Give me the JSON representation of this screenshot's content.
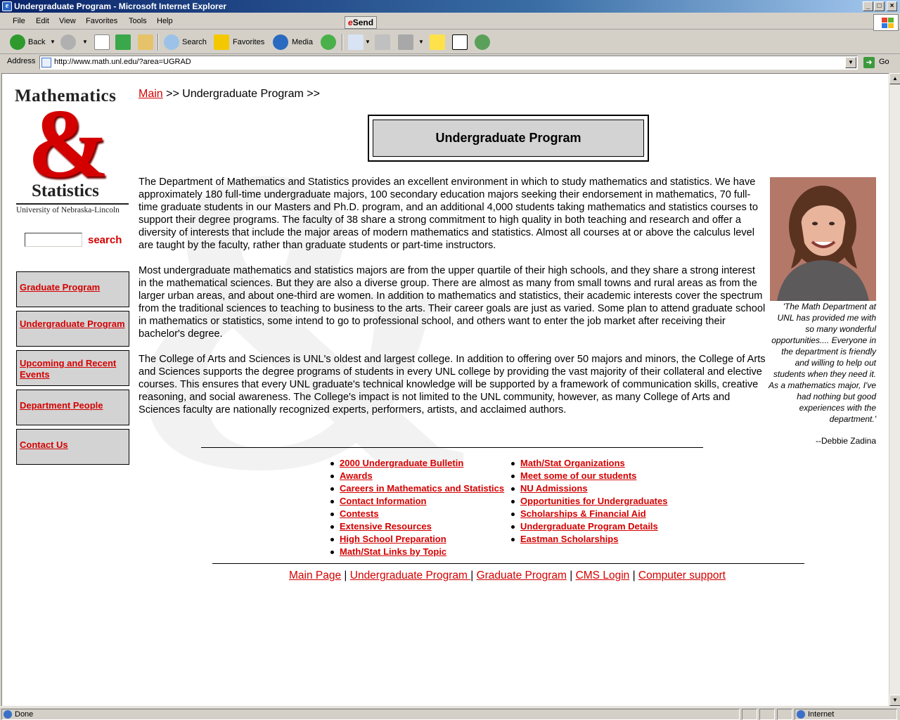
{
  "window": {
    "title": "Undergraduate Program - Microsoft Internet Explorer",
    "controls": {
      "minimize": "_",
      "maximize": "□",
      "close": "×"
    }
  },
  "menu": [
    "File",
    "Edit",
    "View",
    "Favorites",
    "Tools",
    "Help"
  ],
  "send_button": {
    "prefix": "e",
    "label": "Send"
  },
  "toolbar": {
    "back": "Back",
    "search": "Search",
    "favorites": "Favorites",
    "media": "Media"
  },
  "address": {
    "label": "Address",
    "url": "http://www.math.unl.edu/?area=UGRAD",
    "go": "Go"
  },
  "logo": {
    "line1": "Mathematics",
    "amp": "&",
    "line2": "Statistics",
    "line3": "University of Nebraska-Lincoln"
  },
  "search": {
    "value": "",
    "label": "search"
  },
  "sidebar_nav": [
    {
      "label": "Graduate Program"
    },
    {
      "label": "Undergraduate Program"
    },
    {
      "label": "Upcoming and Recent Events"
    },
    {
      "label": "Department People"
    },
    {
      "label": "Contact Us"
    }
  ],
  "breadcrumb": {
    "link": "Main",
    "rest": " >> Undergraduate Program >>"
  },
  "heading": "Undergraduate Program",
  "paragraphs": [
    "The Department of Mathematics and Statistics provides an excellent environment in which to study mathematics and statistics. We have approximately 180 full-time undergraduate majors, 100 secondary education majors seeking their endorsement in mathematics, 70 full-time graduate students in our Masters and Ph.D. program, and an additional 4,000 students taking mathematics and statistics courses to support their degree programs. The faculty of 38 share a strong commitment to high quality in both teaching and research and offer a diversity of interests that include the major areas of modern mathematics and statistics. Almost all courses at or above the calculus level are taught by the faculty, rather than graduate students or part-time instructors.",
    "Most undergraduate mathematics and statistics majors are from the upper quartile of their high schools, and they share a strong interest in the mathematical sciences. But they are also a diverse group. There are almost as many from small towns and rural areas as from the larger urban areas, and about one-third are women. In addition to mathematics and statistics, their academic interests cover the spectrum from the traditional sciences to teaching to business to the arts. Their career goals are just as varied. Some plan to attend graduate school in mathematics or statistics, some intend to go to professional school, and others want to enter the job market after receiving their bachelor's degree.",
    "The College of Arts and Sciences is UNL's oldest and largest college. In addition to offering over 50 majors and minors, the College of Arts and Sciences supports the degree programs of students in every UNL college by providing the vast majority of their collateral and elective courses. This ensures that every UNL graduate's technical knowledge will be supported by a framework of communication skills, creative reasoning, and social awareness. The College's impact is not limited to the UNL community, however, as many College of Arts and Sciences faculty are nationally recognized experts, performers, artists, and acclaimed authors."
  ],
  "quote": {
    "text": "'The Math Department at UNL has provided me with so many wonderful opportunities.... Everyone in the department is friendly and willing to help out students when they need it. As a mathematics major, I've had nothing but good experiences with the department.'",
    "author": "--Debbie Zadina"
  },
  "resource_links_left": [
    "2000 Undergraduate Bulletin",
    "Awards",
    "Careers in Mathematics and Statistics",
    "Contact Information",
    "Contests",
    "Extensive Resources",
    "High School Preparation",
    "Math/Stat Links by Topic"
  ],
  "resource_links_right": [
    "Math/Stat Organizations",
    "Meet some of our students",
    "NU Admissions",
    "Opportunities for Undergraduates",
    "Scholarships & Financial Aid",
    "Undergraduate Program Details",
    "Eastman Scholarships"
  ],
  "footer_links": [
    "Main Page",
    "Undergraduate Program ",
    "Graduate Program",
    "CMS Login",
    "Computer support"
  ],
  "footer_separator": " | ",
  "status": {
    "text": "Done",
    "zone": "Internet"
  }
}
